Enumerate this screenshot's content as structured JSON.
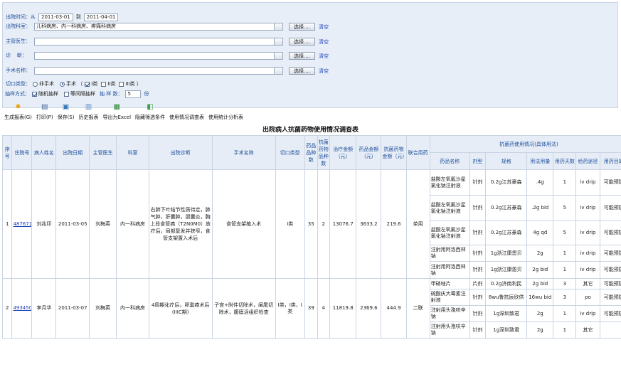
{
  "filters": {
    "date_label": "出院时间：从",
    "date_from": "2011-03-01",
    "date_to_label": "到",
    "date_to": "2011-04-01",
    "dept_label": "出院科室：",
    "dept_value": "儿科病房、内一科病房、疼痛科病房",
    "doctor_label": "主管医生：",
    "doctor_value": "",
    "diagnosis_label": "诊    断：",
    "diagnosis_value": "",
    "surgery_label": "手术名称：",
    "surgery_value": "",
    "select_label": "选择....",
    "clear_label": "清空",
    "incision_label": "切口类型：",
    "non_surgery": "非手术",
    "surgery": "手术 （",
    "type1": "I类",
    "type2": "II类",
    "type3": "III类 ）",
    "sampling_label": "抽样方式：",
    "random": "随机抽样",
    "interval": "等间隔抽样",
    "sample_count_label": "抽 样 数：",
    "sample_count": "5",
    "sample_unit": "份"
  },
  "toolbar": [
    {
      "name": "generate-report-button",
      "icon": "star-icon",
      "glyph": "✸",
      "color": "#e8a317",
      "label": "生成报表(G)"
    },
    {
      "name": "print-button",
      "icon": "printer-icon",
      "glyph": "▤",
      "color": "#4a6a9a",
      "label": "打印(P)"
    },
    {
      "name": "save-button",
      "icon": "save-icon",
      "glyph": "▣",
      "color": "#3a7ab8",
      "label": "保存(S)"
    },
    {
      "name": "history-report-button",
      "icon": "document-icon",
      "glyph": "▥",
      "color": "#5a8ac8",
      "label": "历史报表"
    },
    {
      "name": "export-excel-button",
      "icon": "excel-icon",
      "glyph": "▦",
      "color": "#2f8a3a",
      "label": "导出为Excel"
    },
    {
      "name": "hide-filter-button",
      "icon": "filter-icon",
      "glyph": "◧",
      "color": "#3aa048",
      "label": "隐藏筛选条件"
    },
    {
      "name": "usage-survey-button",
      "icon": "table-icon",
      "glyph": "",
      "color": "#888",
      "label": "使用情况调查表"
    },
    {
      "name": "usage-stats-button",
      "icon": "stats-icon",
      "glyph": "",
      "color": "#888",
      "label": "使用统计分析表"
    }
  ],
  "report": {
    "title": "出院病人抗菌药物使用情况调查表",
    "headers": {
      "seq": "序号",
      "inpatient_no": "住院号",
      "patient_name": "病人姓名",
      "discharge_date": "出院日期",
      "doctor": "主管医生",
      "dept": "科室",
      "diagnosis": "出院诊断",
      "surgery_name": "手术名称",
      "incision": "切口类型",
      "drug_types": "药品品种数",
      "antibiotic_types": "抗菌药物品种数",
      "treatment_cost": "治疗金额（元）",
      "drug_cost": "药品金额（元）",
      "antibiotic_cost": "抗菌药物金额（元）",
      "combo": "联合用药",
      "usage_group": "抗菌药使用情况(具体用法)",
      "drug_name": "药品名称",
      "dosage_form": "剂型",
      "spec": "规格",
      "dose": "用法用量",
      "days": "用药天数",
      "route": "给药途径",
      "purpose": "用药目的"
    },
    "patients": [
      {
        "seq": "1",
        "inpatient_no": "487671",
        "name": "刘兆印",
        "date": "2011-03-05",
        "doctor": "刘梅英",
        "dept": "内一科病房",
        "diagnosis": "右肺下叶结节性质待定，肺气肿，肝囊肿，胆囊炎，胸上段食管癌（T2N0M0）放疗后，局部复发并狭窄，食管支架置入术后",
        "surgery": "食管支架植入术",
        "incision": "I类",
        "drug_types": "35",
        "antibiotic_types": "2",
        "treatment_cost": "13076.7",
        "drug_cost": "3633.2",
        "antibiotic_cost": "219.6",
        "combo": "单用",
        "drugs": [
          {
            "name": "盐酸左氧氟沙星氯化钠注射液",
            "form": "针剂",
            "spec": "0.2g江苏豪森",
            "dose": ".4g",
            "days": "1",
            "route": "iv drip",
            "purpose": "可能预防"
          },
          {
            "name": "盐酸左氧氟沙星氯化钠注射液",
            "form": "针剂",
            "spec": "0.2g江苏豪森",
            "dose": ".2g bid",
            "days": "5",
            "route": "iv drip",
            "purpose": "可能预防"
          },
          {
            "name": "盐酸左氧氟沙星氯化钠注射液",
            "form": "针剂",
            "spec": "0.2g江苏豪森",
            "dose": "4g qd",
            "days": "5",
            "route": "iv drip",
            "purpose": "可能预防"
          },
          {
            "name": "注射用阿洛西林钠",
            "form": "针剂",
            "spec": "1g浙江康恩贝",
            "dose": "2g",
            "days": "1",
            "route": "iv drip",
            "purpose": "可能预防"
          },
          {
            "name": "注射用阿洛西林钠",
            "form": "针剂",
            "spec": "1g浙江康恩贝",
            "dose": "2g bid",
            "days": "1",
            "route": "iv drip",
            "purpose": "可能预防"
          }
        ]
      },
      {
        "seq": "2",
        "inpatient_no": "493450",
        "name": "李月华",
        "date": "2011-03-07",
        "doctor": "刘梅英",
        "dept": "内一科病房",
        "diagnosis": "4周期化疗后，卵巢癌术后(IIIC期)",
        "surgery": "子宫+附件切除术，阑尾切除术，腹膜活组织检查",
        "incision": "I类，I类，I类",
        "drug_types": "39",
        "antibiotic_types": "4",
        "treatment_cost": "11819.8",
        "drug_cost": "2369.6",
        "antibiotic_cost": "444.9",
        "combo": "二联",
        "drugs": [
          {
            "name": "甲硝唑片",
            "form": "片剂",
            "spec": "0.2g济南利民",
            "dose": "2g bid",
            "days": "3",
            "route": "其它",
            "purpose": "可能预防"
          },
          {
            "name": "硫酸庆大霉素注射液",
            "form": "针剂",
            "spec": "8wu鲁抗辰欣供",
            "dose": "16wu bid",
            "days": "3",
            "route": "po",
            "purpose": "可能预防"
          },
          {
            "name": "注射用头孢呋辛钠",
            "form": "针剂",
            "spec": "1g深圳致君",
            "dose": "2g",
            "days": "1",
            "route": "iv drip",
            "purpose": "可能预防"
          },
          {
            "name": "注射用头孢呋辛钠",
            "form": "针剂",
            "spec": "1g深圳致君",
            "dose": "2g",
            "days": "1",
            "route": "其它",
            "purpose": ""
          }
        ]
      }
    ]
  }
}
